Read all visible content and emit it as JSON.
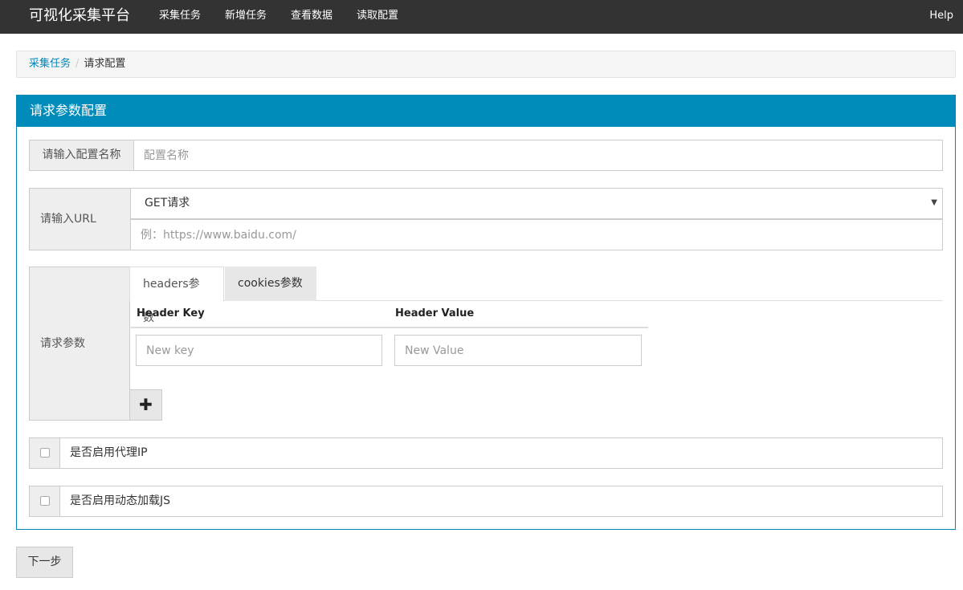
{
  "navbar": {
    "brand": "可视化采集平台",
    "items": [
      "采集任务",
      "新增任务",
      "查看数据",
      "读取配置"
    ],
    "help": "Help"
  },
  "breadcrumb": {
    "link": "采集任务",
    "separator": "/",
    "current": "请求配置"
  },
  "panel": {
    "title": "请求参数配置",
    "config_name": {
      "label": "请输入配置名称",
      "placeholder": "配置名称"
    },
    "url": {
      "label": "请输入URL",
      "method_selected": "GET请求",
      "placeholder": "例：https://www.baidu.com/"
    },
    "params": {
      "label": "请求参数",
      "tabs": [
        "headers参数",
        "cookies参数"
      ],
      "active_tab": "headers参数",
      "columns": [
        "Header Key",
        "Header Value"
      ],
      "key_placeholder": "New key",
      "value_placeholder": "New Value",
      "add_symbol": "✚"
    },
    "proxy": {
      "label": "是否启用代理IP",
      "checked": false
    },
    "dynamic_js": {
      "label": "是否启用动态加载JS",
      "checked": false
    }
  },
  "next_button": "下一步",
  "colors": {
    "navbar": "#333333",
    "primary": "#008cba",
    "link": "#0087b6"
  }
}
